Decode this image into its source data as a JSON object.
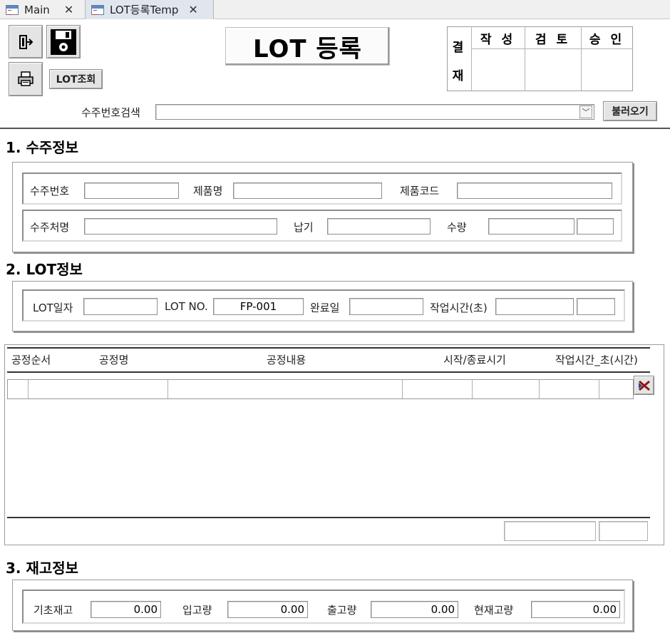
{
  "tabs": [
    {
      "label": "Main",
      "close": "✕"
    },
    {
      "label": "LOT등록Temp",
      "close": "✕"
    }
  ],
  "toolbar": {
    "lot_lookup_label": "LOT조회"
  },
  "title": "LOT 등록",
  "approval": {
    "side_label_1": "결",
    "side_label_2": "재",
    "columns": [
      "작 성",
      "검 토",
      "승 인"
    ]
  },
  "search": {
    "label": "수주번호검색",
    "value": "",
    "load_button": "불러오기"
  },
  "sections": {
    "order_title": "1. 수주정보",
    "lot_title": "2. LOT정보",
    "stock_title": "3. 재고정보"
  },
  "order": {
    "order_no_label": "수주번호",
    "order_no": "",
    "product_name_label": "제품명",
    "product_name": "",
    "product_code_label": "제품코드",
    "product_code": "",
    "customer_label": "수주처명",
    "customer": "",
    "due_label": "납기",
    "due": "",
    "qty_label": "수량",
    "qty": "",
    "qty_unit": ""
  },
  "lot": {
    "date_label": "LOT일자",
    "date": "",
    "no_label": "LOT NO.",
    "no": "FP-001",
    "done_label": "완료일",
    "done": "",
    "worktime_label": "작업시간(초)",
    "worktime": "",
    "worktime2": ""
  },
  "process": {
    "headers": [
      "공정순서",
      "공정명",
      "공정내용",
      "시작/종료시기",
      "작업시간_초(시간)"
    ],
    "footer_total": "",
    "footer_total2": ""
  },
  "stock": {
    "base_label": "기초재고",
    "base": "0.00",
    "in_label": "입고량",
    "in": "0.00",
    "out_label": "출고량",
    "out": "0.00",
    "current_label": "현재고량",
    "current": "0.00"
  }
}
